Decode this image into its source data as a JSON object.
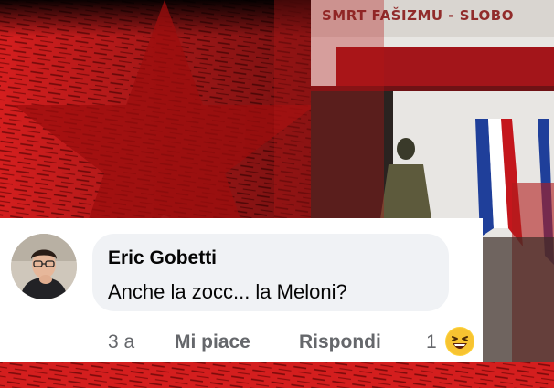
{
  "background": {
    "wall_banner_text": "SMRT FAŠIZMU - SLOBO",
    "accent_red": "#c4161c",
    "flag_colors": [
      "#1f3f9a",
      "#ffffff",
      "#c4161c"
    ]
  },
  "comment": {
    "author": "Eric Gobetti",
    "text": "Anche la zocc... la Meloni?",
    "actions": {
      "time": "3 a",
      "like": "Mi piace",
      "reply": "Rispondi",
      "reaction_count": "1",
      "reaction_icon": "laughing-emoji-icon"
    }
  }
}
